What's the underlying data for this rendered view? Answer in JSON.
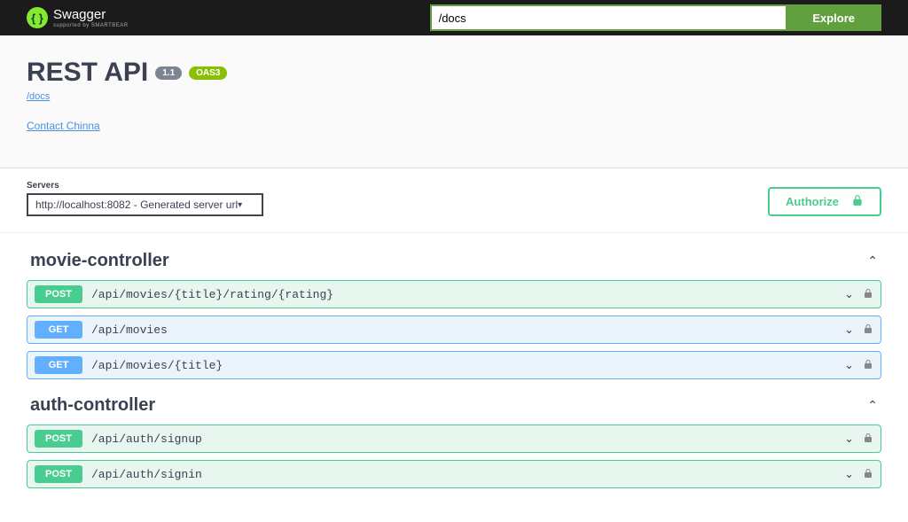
{
  "topbar": {
    "brand": "Swagger",
    "brand_sub": "supported by SMARTBEAR",
    "url_value": "/docs",
    "explore_label": "Explore"
  },
  "info": {
    "title": "REST API",
    "version": "1.1",
    "oas": "OAS3",
    "docs_link": "/docs",
    "contact": "Contact Chinna"
  },
  "servers": {
    "label": "Servers",
    "selected": "http://localhost:8082 - Generated server url"
  },
  "authorize": {
    "label": "Authorize"
  },
  "tags": [
    {
      "name": "movie-controller",
      "ops": [
        {
          "method": "POST",
          "path": "/api/movies/{title}/rating/{rating}"
        },
        {
          "method": "GET",
          "path": "/api/movies"
        },
        {
          "method": "GET",
          "path": "/api/movies/{title}"
        }
      ]
    },
    {
      "name": "auth-controller",
      "ops": [
        {
          "method": "POST",
          "path": "/api/auth/signup"
        },
        {
          "method": "POST",
          "path": "/api/auth/signin"
        }
      ]
    }
  ]
}
